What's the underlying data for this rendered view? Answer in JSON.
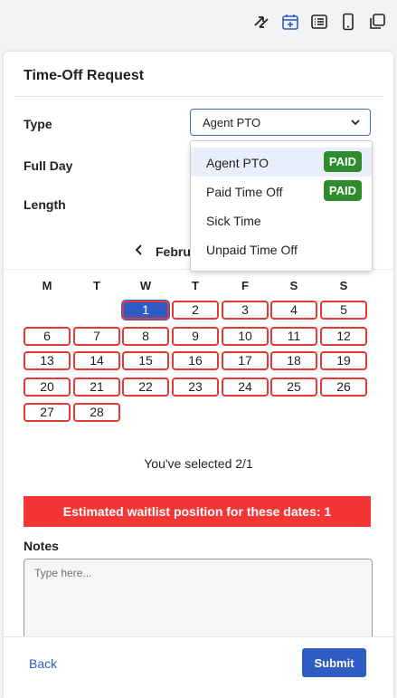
{
  "toolbar": {
    "icons": [
      "swap-icon",
      "calendar-add-icon",
      "list-icon",
      "phone-icon",
      "copy-icon"
    ],
    "active_color": "#2e5cc5"
  },
  "form": {
    "title": "Time-Off Request",
    "type_label": "Type",
    "type_value": "Agent PTO",
    "full_day_label": "Full Day",
    "length_label": "Length",
    "notes_label": "Notes",
    "notes_placeholder": "Type here..."
  },
  "dropdown": {
    "options": [
      {
        "label": "Agent PTO",
        "badge": "PAID",
        "highlighted": true
      },
      {
        "label": "Paid Time Off",
        "badge": "PAID",
        "highlighted": false
      },
      {
        "label": "Sick Time",
        "badge": "",
        "highlighted": false
      },
      {
        "label": "Unpaid Time Off",
        "badge": "",
        "highlighted": false
      }
    ],
    "badge_color": "#2e8b2e"
  },
  "calendar": {
    "month_label": "Februa",
    "weekdays": [
      "M",
      "T",
      "W",
      "T",
      "F",
      "S",
      "S"
    ],
    "weeks": [
      [
        "",
        "",
        "1",
        "2",
        "3",
        "4",
        "5"
      ],
      [
        "6",
        "7",
        "8",
        "9",
        "10",
        "11",
        "12"
      ],
      [
        "13",
        "14",
        "15",
        "16",
        "17",
        "18",
        "19"
      ],
      [
        "20",
        "21",
        "22",
        "23",
        "24",
        "25",
        "26"
      ],
      [
        "27",
        "28",
        "",
        "",
        "",
        "",
        ""
      ]
    ],
    "selected_day": "1",
    "selected_text": "You've selected 2/1",
    "border_color": "#e53935"
  },
  "waitlist": {
    "text": "Estimated waitlist position for these dates: 1",
    "color": "#f43535"
  },
  "footer": {
    "back_label": "Back",
    "submit_label": "Submit"
  }
}
